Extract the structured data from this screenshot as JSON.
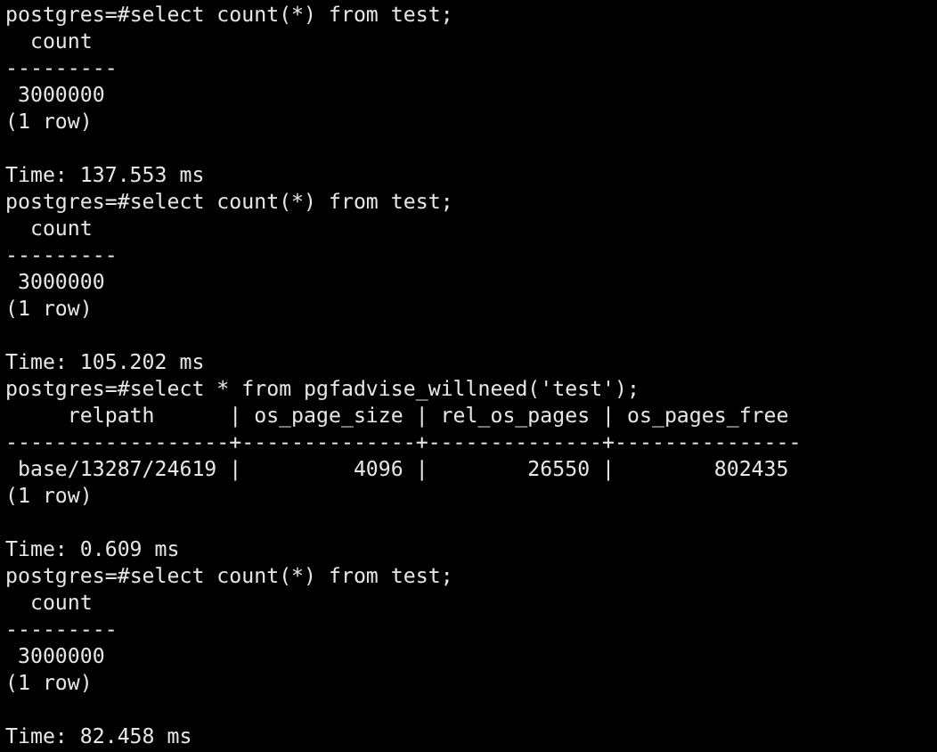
{
  "terminal": {
    "lines": [
      {
        "kind": "command",
        "prompt": "postgres=#",
        "command": "select count(*) from test;"
      },
      {
        "kind": "output",
        "text": "  count"
      },
      {
        "kind": "output",
        "text": "---------"
      },
      {
        "kind": "output",
        "text": " 3000000"
      },
      {
        "kind": "output",
        "text": "(1 row)"
      },
      {
        "kind": "blank"
      },
      {
        "kind": "output",
        "text": "Time: 137.553 ms"
      },
      {
        "kind": "command",
        "prompt": "postgres=#",
        "command": "select count(*) from test;"
      },
      {
        "kind": "output",
        "text": "  count"
      },
      {
        "kind": "output",
        "text": "---------"
      },
      {
        "kind": "output",
        "text": " 3000000"
      },
      {
        "kind": "output",
        "text": "(1 row)"
      },
      {
        "kind": "blank"
      },
      {
        "kind": "output",
        "text": "Time: 105.202 ms"
      },
      {
        "kind": "command",
        "prompt": "postgres=#",
        "command": "select * from pgfadvise_willneed('test');"
      },
      {
        "kind": "output",
        "text": "     relpath      | os_page_size | rel_os_pages | os_pages_free"
      },
      {
        "kind": "output",
        "text": "------------------+--------------+--------------+---------------"
      },
      {
        "kind": "output",
        "text": " base/13287/24619 |         4096 |        26550 |        802435"
      },
      {
        "kind": "output",
        "text": "(1 row)"
      },
      {
        "kind": "blank"
      },
      {
        "kind": "output",
        "text": "Time: 0.609 ms"
      },
      {
        "kind": "command",
        "prompt": "postgres=#",
        "command": "select count(*) from test;"
      },
      {
        "kind": "output",
        "text": "  count"
      },
      {
        "kind": "output",
        "text": "---------"
      },
      {
        "kind": "output",
        "text": " 3000000"
      },
      {
        "kind": "output",
        "text": "(1 row)"
      },
      {
        "kind": "blank"
      },
      {
        "kind": "output",
        "text": "Time: 82.458 ms"
      }
    ]
  }
}
